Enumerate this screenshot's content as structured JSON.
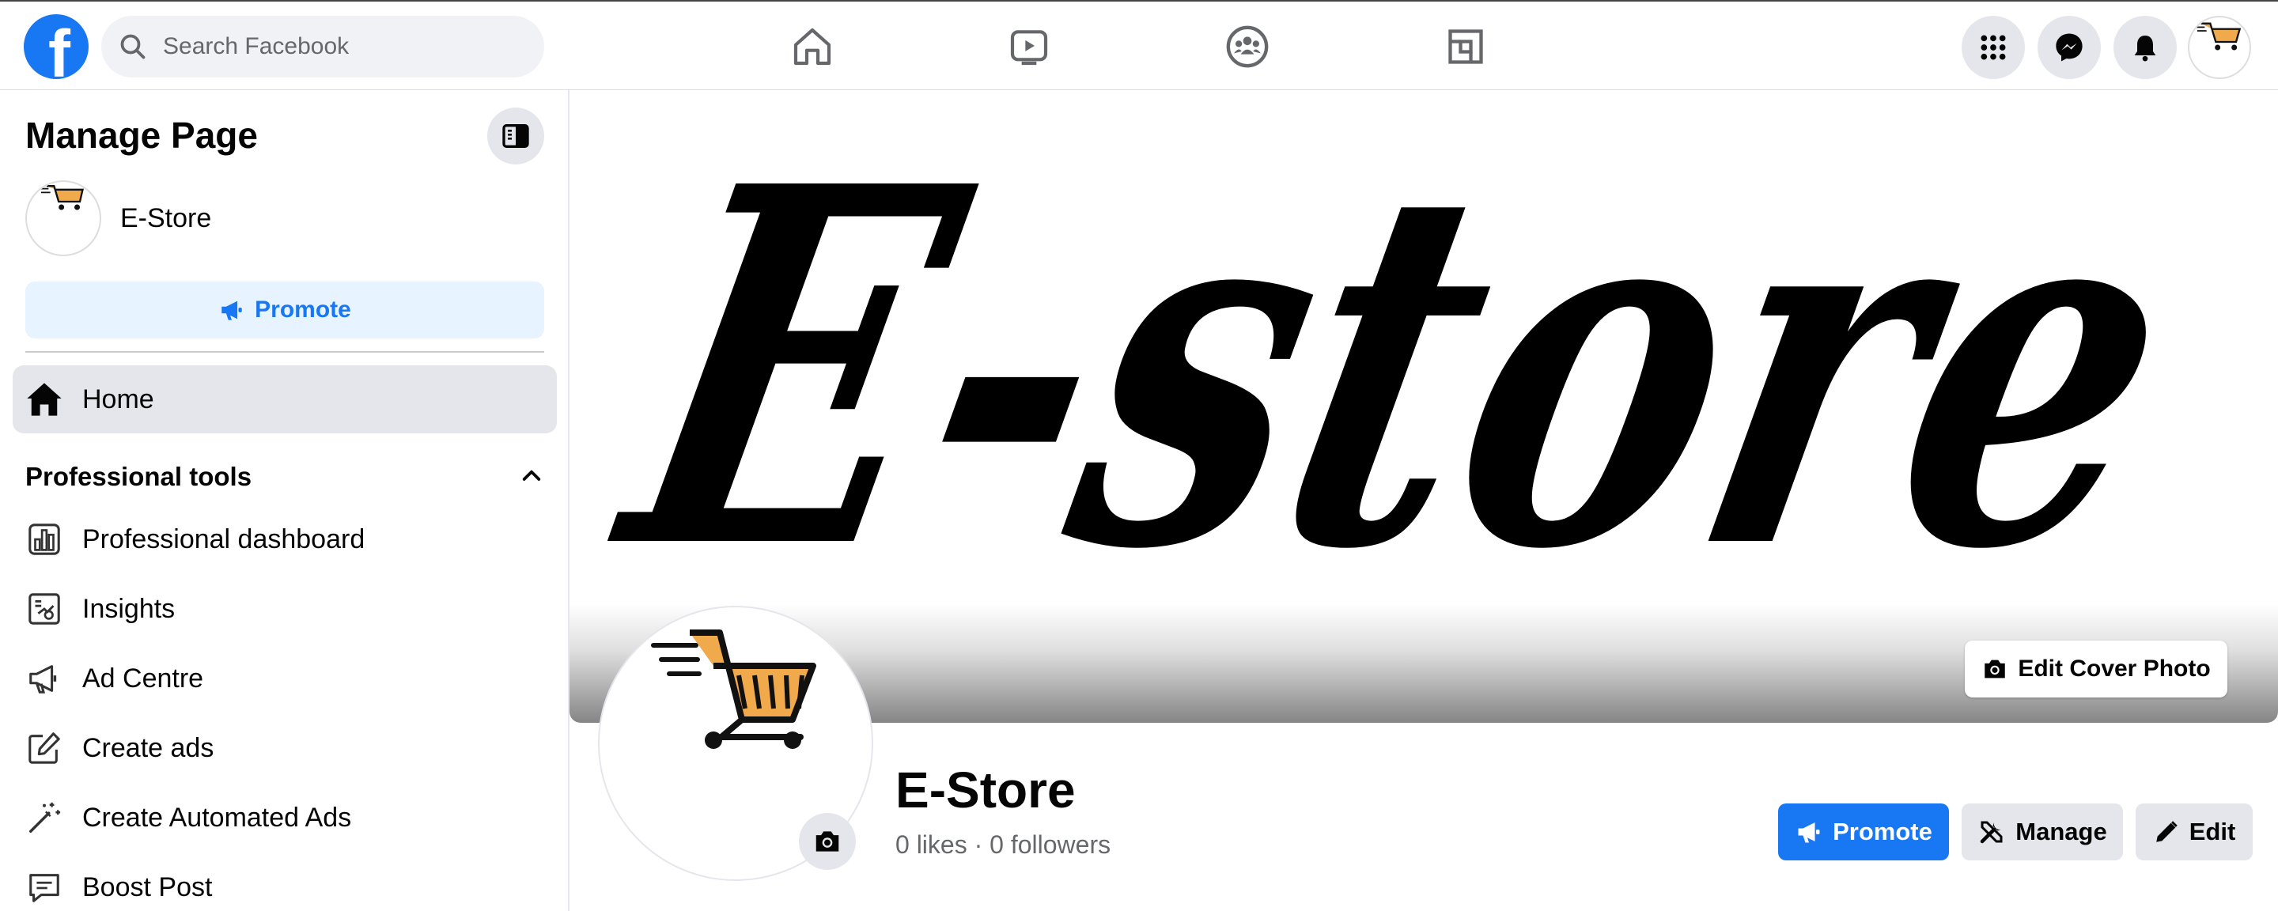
{
  "topbar": {
    "logo_letter": "f",
    "search_placeholder": "Search Facebook"
  },
  "sidebar": {
    "title": "Manage Page",
    "page_name": "E-Store",
    "promote_label": "Promote",
    "home_label": "Home",
    "section_title": "Professional tools",
    "items": [
      {
        "label": "Professional dashboard",
        "icon": "dashboard-icon"
      },
      {
        "label": "Insights",
        "icon": "insights-icon"
      },
      {
        "label": "Ad Centre",
        "icon": "megaphone-icon"
      },
      {
        "label": "Create ads",
        "icon": "edit-square-icon"
      },
      {
        "label": "Create Automated Ads",
        "icon": "magic-wand-icon"
      },
      {
        "label": "Boost Post",
        "icon": "chat-post-icon"
      }
    ]
  },
  "cover": {
    "text": "E-store",
    "edit_label": "Edit Cover Photo"
  },
  "profile": {
    "name": "E-Store",
    "stats": "0 likes · 0 followers",
    "promote_label": "Promote",
    "manage_label": "Manage",
    "edit_label": "Edit"
  },
  "colors": {
    "brand_blue": "#1877f2",
    "light_blue": "#e7f3ff",
    "gray_bg": "#e4e6eb",
    "cart_orange": "#f0a94b"
  }
}
